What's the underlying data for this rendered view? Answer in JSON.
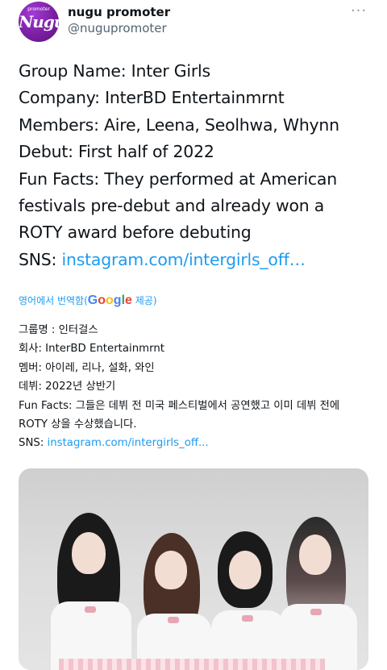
{
  "tweet": {
    "display_name": "nugu promoter",
    "handle": "@nugupromoter",
    "avatar": {
      "top_text": "promoter",
      "main_text": "Nugu",
      "color": "#7b1fa2"
    },
    "more_icon": "more-horizontal-icon",
    "lines": [
      "Group Name: Inter Girls",
      "Company: InterBD Entertainmrnt",
      "Members: Aire, Leena, Seolhwa, Whynn",
      "Debut: First half of 2022",
      "Fun Facts: They performed at American",
      "festivals pre-debut and already won a",
      "ROTY award before debuting"
    ],
    "sns_label": "SNS: ",
    "sns_link": "instagram.com/intergirls_off…",
    "link_color": "#1d9bf0"
  },
  "translation": {
    "translated_from": "영어에서 번역함(",
    "google_letters": [
      "G",
      "o",
      "o",
      "g",
      "l",
      "e"
    ],
    "provided": " 제공)",
    "lines": [
      "그룹명 : 인터걸스",
      " 회사: InterBD Entertainmrnt",
      " 멤버: 아이레, 리나, 설화, 와인",
      " 데뷔: 2022년 상반기",
      " Fun Facts: 그들은 데뷔 전 미국 페스티벌에서 공연했고 이미 데뷔 전에",
      " ROTY 상을 수상했습니다."
    ],
    "sns_label": " SNS: ",
    "sns_link": "instagram.com/intergirls_off..."
  },
  "media": {
    "alt": "group-photo"
  }
}
